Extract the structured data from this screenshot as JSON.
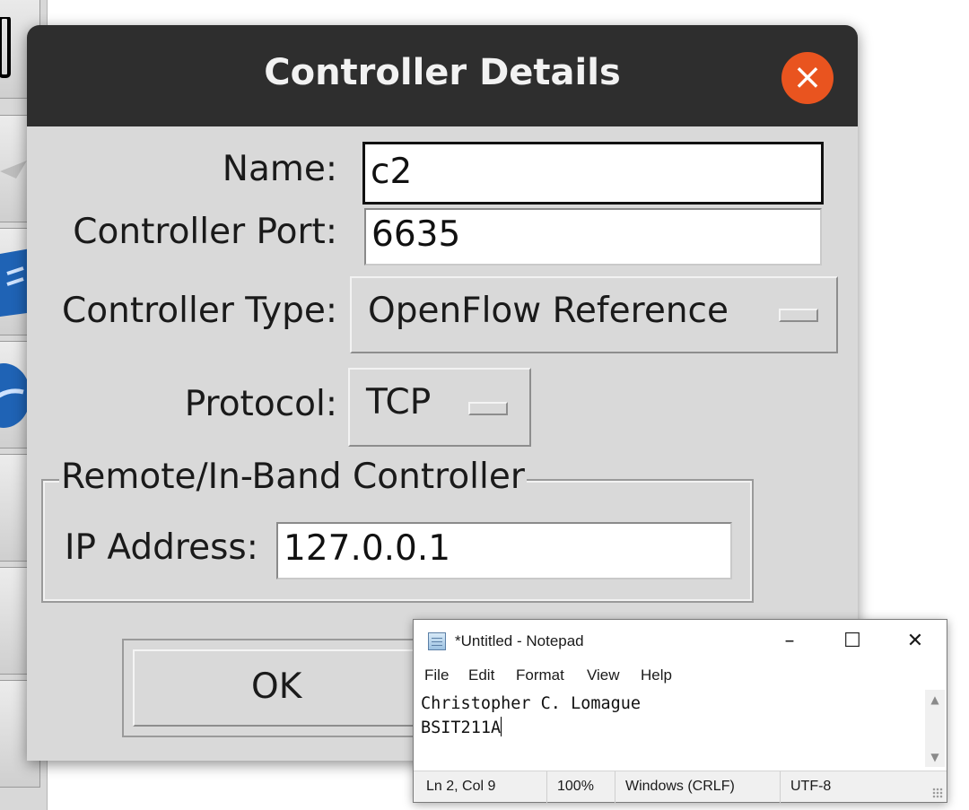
{
  "dialog": {
    "title": "Controller Details",
    "close_icon": "close-x-icon",
    "fields": {
      "name_label": "Name:",
      "name_value": "c2",
      "port_label": "Controller Port:",
      "port_value": "6635",
      "type_label": "Controller Type:",
      "type_value": "OpenFlow Reference",
      "protocol_label": "Protocol:",
      "protocol_value": "TCP"
    },
    "remote_group": {
      "title": "Remote/In-Band Controller",
      "ip_label": "IP Address:",
      "ip_value": "127.0.0.1"
    },
    "ok_label": "OK"
  },
  "notepad": {
    "title": "*Untitled - Notepad",
    "controls": {
      "minimize": "–",
      "maximize": "☐",
      "close": "✕"
    },
    "menu": [
      "File",
      "Edit",
      "Format",
      "View",
      "Help"
    ],
    "lines": [
      "Christopher C. Lomague",
      "BSIT211A"
    ],
    "status": {
      "position": "Ln 2, Col 9",
      "zoom": "100%",
      "line_endings": "Windows (CRLF)",
      "encoding": "UTF-8"
    }
  },
  "colors": {
    "dialog_bg": "#d9d9d9",
    "titlebar_bg": "#2e2e2e",
    "close_button": "#e9541f"
  }
}
